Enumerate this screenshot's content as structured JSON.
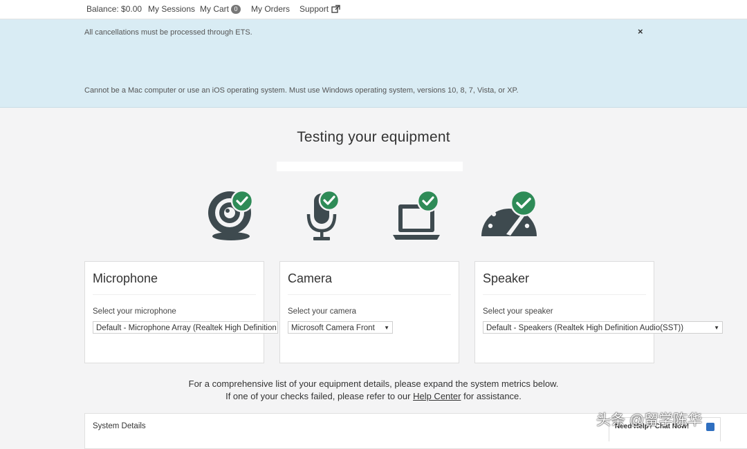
{
  "nav": {
    "balance": "Balance: $0.00",
    "sessions": "My Sessions",
    "cart": "My Cart",
    "cart_count": "0",
    "orders": "My Orders",
    "support": "Support"
  },
  "alert": {
    "line1": "All cancellations must be processed through ETS.",
    "line2": "Cannot be a Mac computer or use an iOS operating system. Must use Windows operating system, versions 10, 8, 7, Vista, or XP.",
    "close": "×"
  },
  "main": {
    "title": "Testing your equipment",
    "progress": 1.0
  },
  "equipment_icons": [
    {
      "name": "webcam-icon",
      "status": "passed"
    },
    {
      "name": "microphone-icon",
      "status": "passed"
    },
    {
      "name": "laptop-icon",
      "status": "passed"
    },
    {
      "name": "speed-gauge-icon",
      "status": "passed"
    }
  ],
  "cards": {
    "microphone": {
      "title": "Microphone",
      "label": "Select your microphone",
      "selected": "Default - Microphone Array (Realtek High Definition"
    },
    "camera": {
      "title": "Camera",
      "label": "Select your camera",
      "selected": "Microsoft Camera Front"
    },
    "speaker": {
      "title": "Speaker",
      "label": "Select your speaker",
      "selected": "Default - Speakers (Realtek High Definition Audio(SST))"
    }
  },
  "info": {
    "line1": "For a comprehensive list of your equipment details, please expand the system metrics below.",
    "line2_before": "If one of your checks failed, please refer to our",
    "help_link": "Help Center",
    "line2_after": "for assistance."
  },
  "system": {
    "title": "System Details"
  },
  "chat": {
    "label": "Need Help? Chat Now!"
  },
  "watermark": "头条 @留学陈华",
  "colors": {
    "accent_green": "#2e8b57",
    "icon_dark": "#3e4a4f",
    "alert_bg": "#d9ecf4"
  }
}
